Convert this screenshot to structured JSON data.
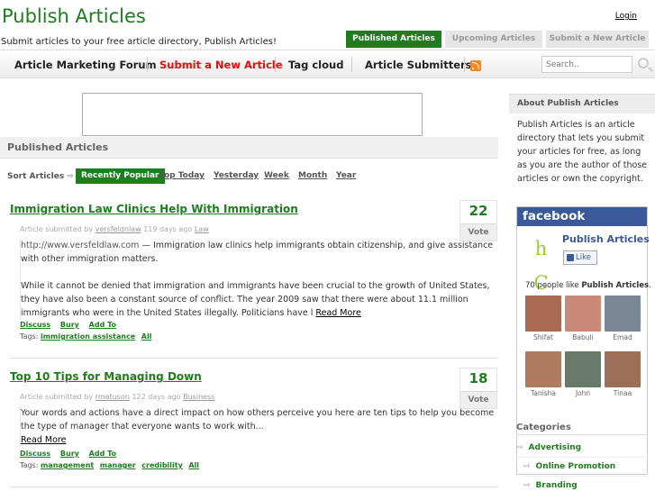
{
  "site": {
    "title": "Publish Articles",
    "tagline": "Submit articles to your free article directory, Publish Articles!",
    "login": "Login"
  },
  "top_tabs": [
    {
      "label": "Published Articles",
      "active": true
    },
    {
      "label": "Upcoming Articles",
      "active": false
    },
    {
      "label": "Submit a New Article",
      "active": false
    }
  ],
  "nav": {
    "items": [
      "Article Marketing Forum",
      "Submit a New Article",
      "Tag cloud",
      "Article Submitters"
    ],
    "rss_icon": "rss-icon",
    "search_placeholder": "Search.."
  },
  "main": {
    "section_title": "Published Articles",
    "sort": {
      "label": "Sort Articles",
      "options": [
        "Recently Popular",
        "Top Today",
        "Yesterday",
        "Week",
        "Month",
        "Year"
      ],
      "active": "Recently Popular"
    },
    "articles": [
      {
        "title": "Immigration Law Clinics Help With Immigration",
        "meta_prefix": "Article submitted by",
        "author": "versfeldnlaw",
        "age": "119 days ago",
        "category": "Law",
        "url": "http://www.versfeldlaw.com",
        "intro": "— Immigration law clinics help immigrants obtain citizenship, and give assistance with other immigration matters.",
        "body": "While it cannot be denied that immigration and immigrants have been crucial to the growth of United States, they have also been a constant source of conflict. The year 2009 saw that there were about 11.1 million immigrants who were in the United States illegally. Politicians have l",
        "read_more": "Read More",
        "actions": [
          "Discuss",
          "Bury",
          "Add To"
        ],
        "tags_label": "Tags:",
        "tags": [
          "immigration assistance",
          "All"
        ],
        "votes": "22",
        "vote_label": "Vote"
      },
      {
        "title": "Top 10 Tips for Managing Down",
        "meta_prefix": "Article submitted by",
        "author": "rmatuson",
        "age": "122 days ago",
        "category": "Business",
        "body": "Your words and actions have a direct impact on how others perceive you here are ten tips to help you become the type of manager that everyone wants to work with...",
        "read_more": "Read More",
        "actions": [
          "Discuss",
          "Bury",
          "Add To"
        ],
        "tags_label": "Tags:",
        "tags": [
          "management",
          "manager",
          "credibility",
          "All"
        ],
        "votes": "18",
        "vote_label": "Vote"
      }
    ]
  },
  "sidebar": {
    "about_title": "About Publish Articles",
    "about_text": "Publish Articles is an article directory that lets you submit your articles for free, as long as you are the author of those articles or own the copyright.",
    "facebook": {
      "brand": "facebook",
      "page_name": "Publish Articles",
      "like_label": "Like",
      "count_text": "70 people like",
      "count_page": "Publish Articles",
      "count_suffix": ".",
      "logo_letters": "h C",
      "fans": [
        {
          "name": "Shifat",
          "color": "#a86b52"
        },
        {
          "name": "Babuli",
          "color": "#c98a7a"
        },
        {
          "name": "Emad",
          "color": "#7a8794"
        },
        {
          "name": "Tanisha",
          "color": "#b07a5e"
        },
        {
          "name": "John",
          "color": "#6a7a6a"
        },
        {
          "name": "Tinaa",
          "color": "#9c7058"
        }
      ]
    },
    "categories_title": "Categories",
    "categories": [
      "Advertising",
      "Online Promotion",
      "Branding"
    ]
  }
}
